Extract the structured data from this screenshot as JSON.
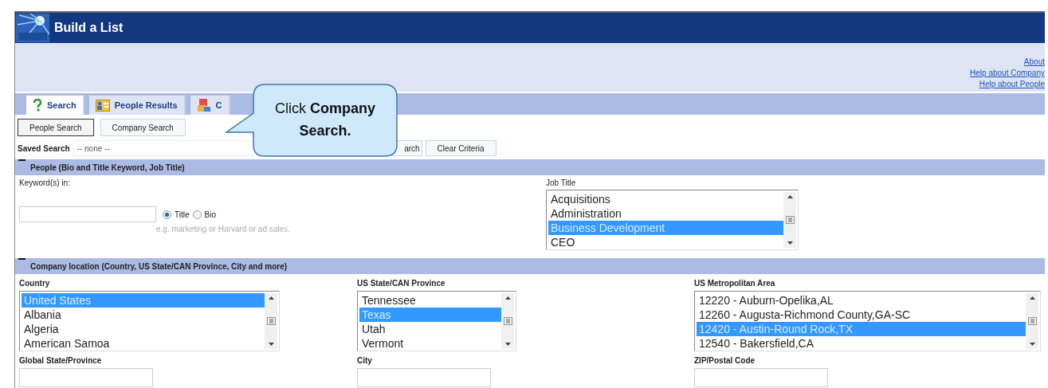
{
  "header": {
    "title": "Build a List"
  },
  "links": [
    "About",
    "Help about Company",
    "Help about People"
  ],
  "tabs": [
    {
      "label": "Search",
      "selected": true
    },
    {
      "label": "People Results",
      "selected": false
    },
    {
      "label": "C",
      "selected": false
    }
  ],
  "search_type_buttons": [
    {
      "label": "People Search",
      "selected": true
    },
    {
      "label": "Company Search",
      "selected": false
    }
  ],
  "saved_search": {
    "label": "Saved Search",
    "value": "-- none --"
  },
  "action_buttons": [
    "arch",
    "Clear Criteria"
  ],
  "callout": {
    "text": "Click **Company Search.**"
  },
  "people_section": {
    "title": "People (Bio and Title Keyword, Job Title)",
    "expanded": true,
    "keyword_label": "Keyword(s) in:",
    "keyword_scope": [
      {
        "label": "Title",
        "selected": true
      },
      {
        "label": "Bio",
        "selected": false
      }
    ],
    "hint": "e.g. marketing or Harvard or ad sales.",
    "job_title": {
      "label": "Job Title",
      "items": [
        {
          "text": "Acquisitions",
          "selected": false
        },
        {
          "text": "Administration",
          "selected": false
        },
        {
          "text": "Business Development",
          "selected": true
        },
        {
          "text": "CEO",
          "selected": false
        }
      ]
    }
  },
  "location_section": {
    "title": "Company location (Country, US State/CAN Province, City and more)",
    "expanded": true,
    "lists": [
      {
        "label": "Country",
        "items": [
          {
            "text": "United States",
            "selected": true
          },
          {
            "text": "Albania",
            "selected": false
          },
          {
            "text": "Algeria",
            "selected": false
          },
          {
            "text": "American Samoa",
            "selected": false
          }
        ]
      },
      {
        "label": "US State/CAN Province",
        "items": [
          {
            "text": "Tennessee",
            "selected": false
          },
          {
            "text": "Texas",
            "selected": true
          },
          {
            "text": "Utah",
            "selected": false
          },
          {
            "text": "Vermont",
            "selected": false
          }
        ]
      },
      {
        "label": "US Metropolitan Area",
        "items": [
          {
            "text": "12220 - Auburn-Opelika,AL",
            "selected": false
          },
          {
            "text": "12260 - Augusta-Richmond County,GA-SC",
            "selected": false
          },
          {
            "text": "12420 - Austin-Round Rock,TX",
            "selected": true
          },
          {
            "text": "12540 - Bakersfield,CA",
            "selected": false
          }
        ]
      }
    ],
    "fields": [
      "Global State/Province",
      "City",
      "ZIP/Postal Code"
    ]
  }
}
